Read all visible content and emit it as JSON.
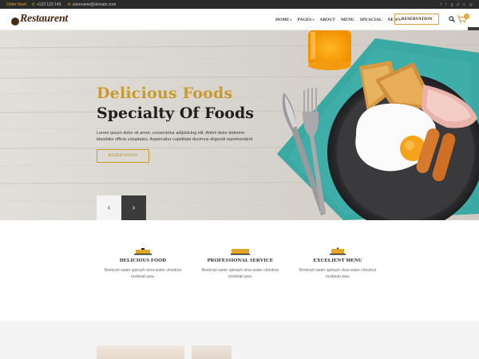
{
  "topbar": {
    "order_label": "Order Now!",
    "phone": "+123 123 145",
    "email": "username@domain.com"
  },
  "header": {
    "logo_text": "Restaurent",
    "nav": [
      "HOME",
      "PAGES",
      "ABOUT",
      "MENU",
      "SPEACIAL",
      "NEWS"
    ],
    "reservation_label": "RESERVATION",
    "cart_count": "0"
  },
  "hero": {
    "title_line1": "Delicious Foods",
    "title_line2": "Specialty Of Foods",
    "paragraph": "Lorem ipsum dolor sit amet, consectetur adipisicing elit. Animi dolor dolorem blanditiis officia voluptates. Aspernatur cupiditate ducimus eligendi reprehenderit",
    "button_label": "RESERVATION",
    "prev_arrow": "‹",
    "next_arrow": "›"
  },
  "features": [
    {
      "title": "DELICIOUS FOOD",
      "desc": "Beetroot water spinach okra water chestnut ricebean pea."
    },
    {
      "title": "PROFESSIONAL SERVICE",
      "desc": "Beetroot water spinach okra water chestnut ricebean pea."
    },
    {
      "title": "EXCELIENT MENU",
      "desc": "Beetroot water spinach okra water chestnut ricebean pea."
    }
  ],
  "colors": {
    "accent": "#c99b2d",
    "dark": "#2b2b2b",
    "teal": "#3aa6a0"
  }
}
